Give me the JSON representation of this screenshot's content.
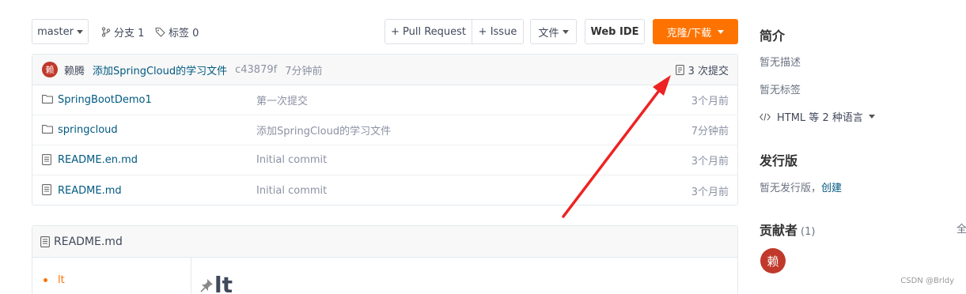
{
  "toolbar": {
    "branch": "master",
    "branches": "分支 1",
    "tags": "标签 0",
    "pull_request": "+ Pull Request",
    "issue": "+ Issue",
    "file": "文件",
    "web_ide": "Web IDE",
    "clone": "克隆/下载"
  },
  "commit": {
    "avatar": "赖",
    "author": "赖腾",
    "message": "添加SpringCloud的学习文件",
    "hash": "c43879f",
    "time": "7分钟前",
    "count": "3 次提交"
  },
  "files": [
    {
      "name": "SpringBootDemo1",
      "type": "folder",
      "message": "第一次提交",
      "time": "3个月前"
    },
    {
      "name": "springcloud",
      "type": "folder",
      "message": "添加SpringCloud的学习文件",
      "time": "7分钟前"
    },
    {
      "name": "README.en.md",
      "type": "file",
      "message": "Initial commit",
      "time": "3个月前"
    },
    {
      "name": "README.md",
      "type": "file",
      "message": "Initial commit",
      "time": "3个月前"
    }
  ],
  "readme": {
    "filename": "README.md",
    "toc_item": "lt",
    "heading": "lt"
  },
  "sidebar": {
    "intro_title": "简介",
    "no_description": "暂无描述",
    "no_tags": "暂无标签",
    "languages": "HTML 等 2 种语言",
    "releases_title": "发行版",
    "no_releases": "暂无发行版，",
    "create": "创建",
    "contributors_title": "贡献者",
    "contributors_count": "(1)",
    "all": "全",
    "contributor_avatar": "赖"
  },
  "watermark": "CSDN @Brldy",
  "colors": {
    "accent": "#fe7300",
    "link": "#005980",
    "avatar": "#c0392b",
    "annotation_arrow": "#ee2222"
  }
}
